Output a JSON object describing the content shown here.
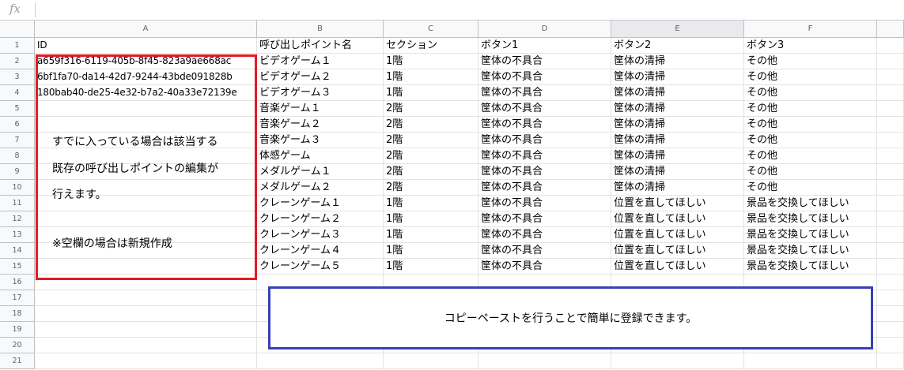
{
  "formula_bar": {
    "icon": "fx-icon",
    "label": "fx",
    "value": ""
  },
  "columns": [
    "A",
    "B",
    "C",
    "D",
    "E",
    "F"
  ],
  "selected_column": "E",
  "row_numbers": [
    "1",
    "2",
    "3",
    "4",
    "5",
    "6",
    "7",
    "8",
    "9",
    "10",
    "11",
    "12",
    "13",
    "14",
    "15",
    "16",
    "17",
    "18",
    "19",
    "20",
    "21"
  ],
  "rows": [
    [
      "ID",
      "呼び出しポイント名",
      "セクション",
      "ボタン1",
      "ボタン2",
      "ボタン3"
    ],
    [
      "a659f316-6119-405b-8f45-823a9ae668ac",
      "ビデオゲーム１",
      "1階",
      "筐体の不具合",
      "筐体の清掃",
      "その他"
    ],
    [
      "6bf1fa70-da14-42d7-9244-43bde091828b",
      "ビデオゲーム２",
      "1階",
      "筐体の不具合",
      "筐体の清掃",
      "その他"
    ],
    [
      "180bab40-de25-4e32-b7a2-40a33e72139e",
      "ビデオゲーム３",
      "1階",
      "筐体の不具合",
      "筐体の清掃",
      "その他"
    ],
    [
      "",
      "音楽ゲーム１",
      "2階",
      "筐体の不具合",
      "筐体の清掃",
      "その他"
    ],
    [
      "",
      "音楽ゲーム２",
      "2階",
      "筐体の不具合",
      "筐体の清掃",
      "その他"
    ],
    [
      "",
      "音楽ゲーム３",
      "2階",
      "筐体の不具合",
      "筐体の清掃",
      "その他"
    ],
    [
      "",
      "体感ゲーム",
      "2階",
      "筐体の不具合",
      "筐体の清掃",
      "その他"
    ],
    [
      "",
      "メダルゲーム１",
      "2階",
      "筐体の不具合",
      "筐体の清掃",
      "その他"
    ],
    [
      "",
      "メダルゲーム２",
      "2階",
      "筐体の不具合",
      "筐体の清掃",
      "その他"
    ],
    [
      "",
      "クレーンゲーム１",
      "1階",
      "筐体の不具合",
      "位置を直してほしい",
      "景品を交換してほしい"
    ],
    [
      "",
      "クレーンゲーム２",
      "1階",
      "筐体の不具合",
      "位置を直してほしい",
      "景品を交換してほしい"
    ],
    [
      "",
      "クレーンゲーム３",
      "1階",
      "筐体の不具合",
      "位置を直してほしい",
      "景品を交換してほしい"
    ],
    [
      "",
      "クレーンゲーム４",
      "1階",
      "筐体の不具合",
      "位置を直してほしい",
      "景品を交換してほしい"
    ],
    [
      "",
      "クレーンゲーム５",
      "1階",
      "筐体の不具合",
      "位置を直してほしい",
      "景品を交換してほしい"
    ]
  ],
  "annotations": {
    "red_note_lines": [
      "すでに入っている場合は該当する",
      "既存の呼び出しポイントの編集が",
      "行えます。",
      "※空欄の場合は新規作成"
    ],
    "blue_note": "コピーペーストを行うことで簡単に登録できます。",
    "red_color": "#e01c24",
    "blue_color": "#3a3fb8"
  }
}
